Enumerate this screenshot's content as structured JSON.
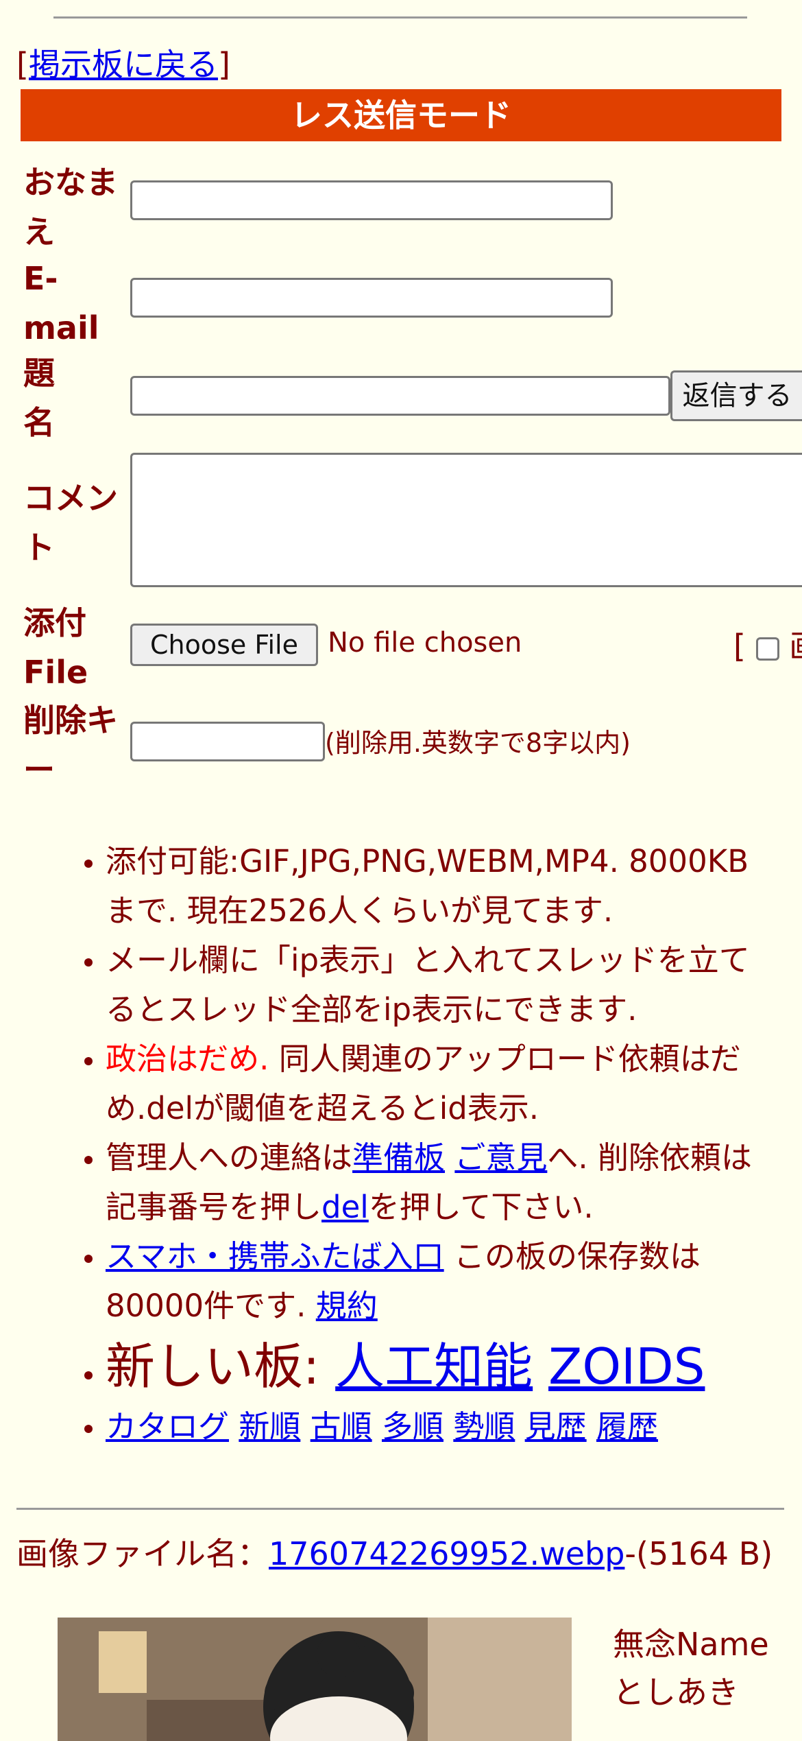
{
  "nav": {
    "back_open": "[",
    "back_label": "掲示板に戻る",
    "back_close": "]"
  },
  "form": {
    "mode_title": "レス送信モード",
    "name_label": "おなまえ",
    "email_label": "E-mail",
    "subject_label": "題名",
    "comment_label": "コメント",
    "file_label": "添付File",
    "delkey_label": "削除キー",
    "submit_label": "返信する",
    "file_button": "Choose File",
    "file_status": "No file chosen",
    "checkbox_prefix": "[",
    "checkbox_label": "画",
    "delkey_note": "(削除用.英数字で8字以内)"
  },
  "rules": {
    "r1": "添付可能:GIF,JPG,PNG,WEBM,MP4. 8000KBまで. 現在2526人くらいが見てます.",
    "r2": "メール欄に「ip表示」と入れてスレッドを立てるとスレッド全部をip表示にできます.",
    "r3_red": "政治はだめ.",
    "r3_rest": " 同人関連のアップロード依頼はだめ.delが閾値を超えるとid表示.",
    "r4_a": "管理人への連絡は",
    "r4_link1": "準備板",
    "r4_link2": "ご意見",
    "r4_b": "へ. 削除依頼は記事番号を押し",
    "r4_link3": "del",
    "r4_c": "を押して下さい.",
    "r5_link": "スマホ・携帯ふたば入口",
    "r5_text": " この板の保存数は80000件です. ",
    "r5_link2": "規約",
    "r6_text": "新しい板: ",
    "r6_link1": "人工知能",
    "r6_link2": "ZOIDS",
    "r7_links": [
      "カタログ",
      "新順",
      "古順",
      "多順",
      "勢順",
      "見歴",
      "履歴"
    ]
  },
  "post": {
    "file_prefix": "画像ファイル名：",
    "file_name": "1760742269952.webp",
    "file_size": "-(5164 B)",
    "name_line1": "無念Name",
    "name_line2": "としあき"
  }
}
